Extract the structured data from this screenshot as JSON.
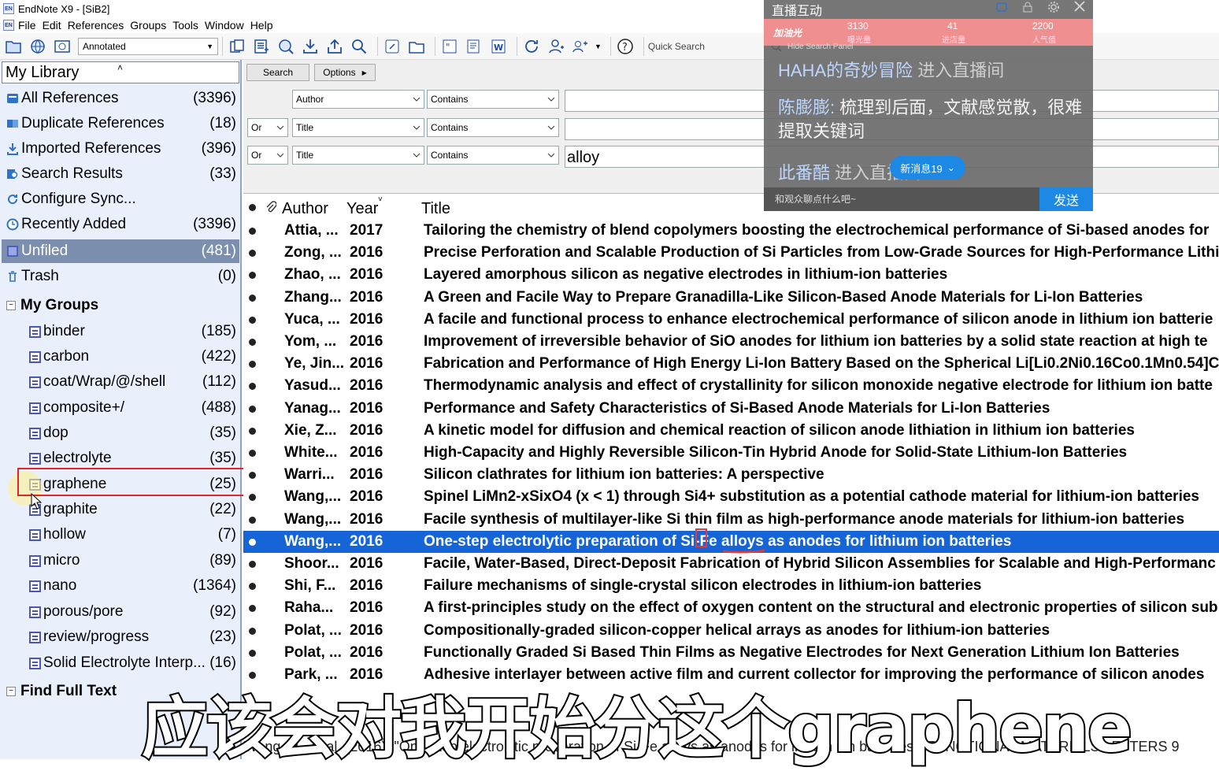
{
  "window": {
    "title": "EndNote X9 - [SiB2]",
    "app_icon": "EN"
  },
  "menu": [
    "File",
    "Edit",
    "References",
    "Groups",
    "Tools",
    "Window",
    "Help"
  ],
  "toolbar": {
    "style_select": "Annotated",
    "quick_search_placeholder": "Quick Search"
  },
  "library": {
    "header": "My Library",
    "items": [
      {
        "label": "All References",
        "count": "(3396)",
        "icon": "all-references-icon"
      },
      {
        "label": "Duplicate References",
        "count": "(18)",
        "icon": "duplicate-icon"
      },
      {
        "label": "Imported References",
        "count": "(396)",
        "icon": "import-icon"
      },
      {
        "label": "Search Results",
        "count": "(33)",
        "icon": "search-results-icon"
      },
      {
        "label": "Configure Sync...",
        "count": "",
        "icon": "sync-icon"
      },
      {
        "label": "Recently Added",
        "count": "(3396)",
        "icon": "clock-icon"
      },
      {
        "label": "Unfiled",
        "count": "(481)",
        "icon": "unfiled-icon"
      },
      {
        "label": "Trash",
        "count": "(0)",
        "icon": "trash-icon"
      }
    ],
    "groups_header": "My Groups",
    "groups": [
      {
        "label": "binder",
        "count": "(185)"
      },
      {
        "label": "carbon",
        "count": "(422)"
      },
      {
        "label": "coat/Wrap/@/shell",
        "count": "(112)"
      },
      {
        "label": "composite+/",
        "count": "(488)"
      },
      {
        "label": "dop",
        "count": "(35)"
      },
      {
        "label": "electrolyte",
        "count": "(35)"
      },
      {
        "label": "graphene",
        "count": "(25)"
      },
      {
        "label": "graphite",
        "count": "(22)"
      },
      {
        "label": "hollow",
        "count": "(7)"
      },
      {
        "label": "micro",
        "count": "(89)"
      },
      {
        "label": "nano",
        "count": "(1364)"
      },
      {
        "label": "porous/pore",
        "count": "(92)"
      },
      {
        "label": "review/progress",
        "count": "(23)"
      },
      {
        "label": "Solid Electrolyte Interp...",
        "count": "(16)"
      }
    ],
    "fulltext_header": "Find Full Text"
  },
  "search": {
    "search_button": "Search",
    "options_button": "Options",
    "rows": [
      {
        "bool": "",
        "field": "Author",
        "op": "Contains",
        "value": ""
      },
      {
        "bool": "Or",
        "field": "Title",
        "op": "Contains",
        "value": ""
      },
      {
        "bool": "Or",
        "field": "Title",
        "op": "Contains",
        "value": "alloy"
      }
    ]
  },
  "table": {
    "headers": {
      "author": "Author",
      "year": "Year",
      "title": "Title"
    },
    "rows": [
      {
        "author": "Attia, ...",
        "year": "2017",
        "title": "Tailoring the chemistry of blend copolymers boosting the electrochemical performance of Si-based anodes for"
      },
      {
        "author": "Zong, ...",
        "year": "2016",
        "title": "Precise Perforation and Scalable Production of Si Particles from Low-Grade Sources for High-Performance Lithi"
      },
      {
        "author": "Zhao, ...",
        "year": "2016",
        "title": "Layered amorphous silicon as negative electrodes in lithium-ion batteries"
      },
      {
        "author": "Zhang...",
        "year": "2016",
        "title": "A Green and Facile Way to Prepare Granadilla-Like Silicon-Based Anode Materials for Li-Ion Batteries"
      },
      {
        "author": "Yuca, ...",
        "year": "2016",
        "title": "A facile and functional process to enhance electrochemical performance of silicon anode in lithium ion batterie"
      },
      {
        "author": "Yom, ...",
        "year": "2016",
        "title": "Improvement of irreversible behavior of SiO anodes for lithium ion batteries by a solid state reaction at high te"
      },
      {
        "author": "Ye, Jin...",
        "year": "2016",
        "title": "Fabrication and Performance of High Energy Li-Ion Battery Based on the Spherical Li[Li0.2Ni0.16Co0.1Mn0.54]C"
      },
      {
        "author": "Yasud...",
        "year": "2016",
        "title": "Thermodynamic analysis and effect of crystallinity for silicon monoxide negative electrode for lithium ion batte"
      },
      {
        "author": "Yanag...",
        "year": "2016",
        "title": "Performance and Safety Characteristics of Si-Based Anode Materials for Li-Ion Batteries"
      },
      {
        "author": "Xie, Z...",
        "year": "2016",
        "title": "A kinetic model for diffusion and chemical reaction of silicon anode lithiation in lithium ion batteries"
      },
      {
        "author": "White...",
        "year": "2016",
        "title": "High-Capacity and Highly Reversible Silicon-Tin Hybrid Anode for Solid-State Lithium-Ion Batteries"
      },
      {
        "author": "Warri...",
        "year": "2016",
        "title": "Silicon clathrates for lithium ion batteries: A perspective"
      },
      {
        "author": "Wang,...",
        "year": "2016",
        "title": "Spinel LiMn2-xSixO4 (x < 1) through Si4+ substitution as a potential cathode material for lithium-ion batteries"
      },
      {
        "author": "Wang,...",
        "year": "2016",
        "title": "Facile synthesis of multilayer-like Si thin film as high-performance anode materials for lithium-ion batteries"
      },
      {
        "author": "Wang,...",
        "year": "2016",
        "title": "One-step electrolytic preparation of Si-Fe alloys as anodes for lithium ion batteries"
      },
      {
        "author": "Shoor...",
        "year": "2016",
        "title": "Facile, Water-Based, Direct-Deposit Fabrication of Hybrid Silicon Assemblies for Scalable and High-Performanc"
      },
      {
        "author": "Shi, F...",
        "year": "2016",
        "title": "Failure mechanisms of single-crystal silicon electrodes in lithium-ion batteries"
      },
      {
        "author": "Raha...",
        "year": "2016",
        "title": "A first-principles study on the effect of oxygen content on the structural and electronic properties of silicon sub"
      },
      {
        "author": "Polat, ...",
        "year": "2016",
        "title": "Compositionally-graded silicon-copper helical arrays as anodes for lithium-ion batteries"
      },
      {
        "author": "Polat, ...",
        "year": "2016",
        "title": "Functionally Graded Si Based Thin Films as Negative Electrodes for Next Generation Lithium Ion Batteries"
      },
      {
        "author": "Park, ...",
        "year": "2016",
        "title": "Adhesive interlayer between active film and current collector for improving the performance of silicon anodes"
      }
    ],
    "selected_index": 14
  },
  "bottom_preview": "Wang, H., et al. (2016). \"One-step electrolytic preparation of Si-Fe alloys as anodes for lithium ion batteries.\" FUNCTIONAL MATERIALS LETTERS 9",
  "live_panel": {
    "title": "直播互动",
    "stats": [
      {
        "value": "3130",
        "label": "曝光量"
      },
      {
        "value": "41",
        "label": "进店量"
      },
      {
        "value": "2200",
        "label": "人气值"
      }
    ],
    "brand": "加油光",
    "hide_label": "Hide Search Panel",
    "messages": [
      {
        "user": "HAHA的奇妙冒险",
        "text": "进入直播间"
      },
      {
        "user": "陈膨膨:",
        "text": "梳理到后面，文献感觉散，很难提取关键词"
      },
      {
        "user": "此番酷",
        "text": "进入直播间"
      }
    ],
    "new_messages": "新消息19",
    "input_placeholder": "和观众聊点什么吧~",
    "send": "发送"
  },
  "subtitle": "应该会对我开始分这个graphene"
}
